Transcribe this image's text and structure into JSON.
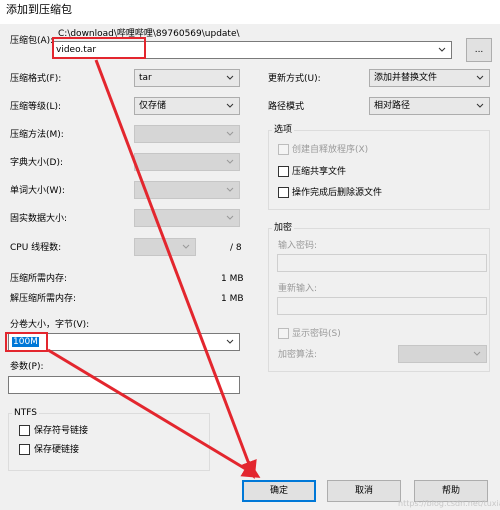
{
  "window": {
    "title": "添加到压缩包"
  },
  "archive": {
    "path": "C:\\download\\哔哩哔哩\\89760569\\update\\",
    "label": "压缩包(A):",
    "name": "video.tar",
    "browse_label": "..."
  },
  "left": {
    "format": {
      "label": "压缩格式(F):",
      "value": "tar"
    },
    "level": {
      "label": "压缩等级(L):",
      "value": "仅存储"
    },
    "method": {
      "label": "压缩方法(M):",
      "value": ""
    },
    "dict": {
      "label": "字典大小(D):",
      "value": ""
    },
    "word": {
      "label": "单词大小(W):",
      "value": ""
    },
    "solid": {
      "label": "固实数据大小:",
      "value": ""
    },
    "cpu": {
      "label": "CPU 线程数:",
      "value": "",
      "total": "/ 8"
    },
    "mem_compress": {
      "label": "压缩所需内存:",
      "value": "1 MB"
    },
    "mem_decompress": {
      "label": "解压缩所需内存:",
      "value": "1 MB"
    },
    "split": {
      "label": "分卷大小，字节(V):",
      "value": "100M"
    },
    "params": {
      "label": "参数(P):",
      "value": ""
    }
  },
  "ntfs": {
    "title": "NTFS",
    "symlinks": "保存符号链接",
    "hardlinks": "保存硬链接"
  },
  "right": {
    "update_mode": {
      "label": "更新方式(U):",
      "value": "添加并替换文件"
    },
    "path_mode": {
      "label": "路径模式",
      "value": "相对路径"
    }
  },
  "options": {
    "title": "选项",
    "sfx": "创建自释放程序(X)",
    "shared": "压缩共享文件",
    "delete": "操作完成后删除源文件"
  },
  "encryption": {
    "title": "加密",
    "password_label": "输入密码:",
    "reenter_label": "重新输入:",
    "show_password": "显示密码(S)",
    "method_label": "加密算法:"
  },
  "buttons": {
    "ok": "确定",
    "cancel": "取消",
    "help": "帮助"
  },
  "watermark": "https://blog.csdn.net/tuxiaofo",
  "annotation_color": "#e3262e"
}
